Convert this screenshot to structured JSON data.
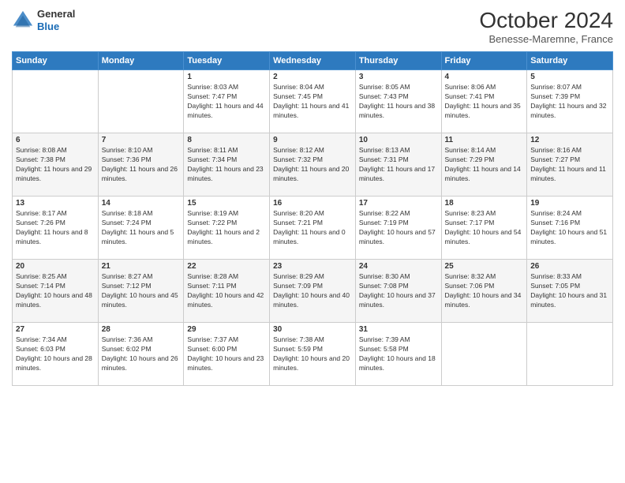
{
  "header": {
    "logo": {
      "line1": "General",
      "line2": "Blue"
    },
    "month_title": "October 2024",
    "subtitle": "Benesse-Maremne, France"
  },
  "days_of_week": [
    "Sunday",
    "Monday",
    "Tuesday",
    "Wednesday",
    "Thursday",
    "Friday",
    "Saturday"
  ],
  "weeks": [
    [
      {
        "day": "",
        "sunrise": "",
        "sunset": "",
        "daylight": ""
      },
      {
        "day": "",
        "sunrise": "",
        "sunset": "",
        "daylight": ""
      },
      {
        "day": "1",
        "sunrise": "Sunrise: 8:03 AM",
        "sunset": "Sunset: 7:47 PM",
        "daylight": "Daylight: 11 hours and 44 minutes."
      },
      {
        "day": "2",
        "sunrise": "Sunrise: 8:04 AM",
        "sunset": "Sunset: 7:45 PM",
        "daylight": "Daylight: 11 hours and 41 minutes."
      },
      {
        "day": "3",
        "sunrise": "Sunrise: 8:05 AM",
        "sunset": "Sunset: 7:43 PM",
        "daylight": "Daylight: 11 hours and 38 minutes."
      },
      {
        "day": "4",
        "sunrise": "Sunrise: 8:06 AM",
        "sunset": "Sunset: 7:41 PM",
        "daylight": "Daylight: 11 hours and 35 minutes."
      },
      {
        "day": "5",
        "sunrise": "Sunrise: 8:07 AM",
        "sunset": "Sunset: 7:39 PM",
        "daylight": "Daylight: 11 hours and 32 minutes."
      }
    ],
    [
      {
        "day": "6",
        "sunrise": "Sunrise: 8:08 AM",
        "sunset": "Sunset: 7:38 PM",
        "daylight": "Daylight: 11 hours and 29 minutes."
      },
      {
        "day": "7",
        "sunrise": "Sunrise: 8:10 AM",
        "sunset": "Sunset: 7:36 PM",
        "daylight": "Daylight: 11 hours and 26 minutes."
      },
      {
        "day": "8",
        "sunrise": "Sunrise: 8:11 AM",
        "sunset": "Sunset: 7:34 PM",
        "daylight": "Daylight: 11 hours and 23 minutes."
      },
      {
        "day": "9",
        "sunrise": "Sunrise: 8:12 AM",
        "sunset": "Sunset: 7:32 PM",
        "daylight": "Daylight: 11 hours and 20 minutes."
      },
      {
        "day": "10",
        "sunrise": "Sunrise: 8:13 AM",
        "sunset": "Sunset: 7:31 PM",
        "daylight": "Daylight: 11 hours and 17 minutes."
      },
      {
        "day": "11",
        "sunrise": "Sunrise: 8:14 AM",
        "sunset": "Sunset: 7:29 PM",
        "daylight": "Daylight: 11 hours and 14 minutes."
      },
      {
        "day": "12",
        "sunrise": "Sunrise: 8:16 AM",
        "sunset": "Sunset: 7:27 PM",
        "daylight": "Daylight: 11 hours and 11 minutes."
      }
    ],
    [
      {
        "day": "13",
        "sunrise": "Sunrise: 8:17 AM",
        "sunset": "Sunset: 7:26 PM",
        "daylight": "Daylight: 11 hours and 8 minutes."
      },
      {
        "day": "14",
        "sunrise": "Sunrise: 8:18 AM",
        "sunset": "Sunset: 7:24 PM",
        "daylight": "Daylight: 11 hours and 5 minutes."
      },
      {
        "day": "15",
        "sunrise": "Sunrise: 8:19 AM",
        "sunset": "Sunset: 7:22 PM",
        "daylight": "Daylight: 11 hours and 2 minutes."
      },
      {
        "day": "16",
        "sunrise": "Sunrise: 8:20 AM",
        "sunset": "Sunset: 7:21 PM",
        "daylight": "Daylight: 11 hours and 0 minutes."
      },
      {
        "day": "17",
        "sunrise": "Sunrise: 8:22 AM",
        "sunset": "Sunset: 7:19 PM",
        "daylight": "Daylight: 10 hours and 57 minutes."
      },
      {
        "day": "18",
        "sunrise": "Sunrise: 8:23 AM",
        "sunset": "Sunset: 7:17 PM",
        "daylight": "Daylight: 10 hours and 54 minutes."
      },
      {
        "day": "19",
        "sunrise": "Sunrise: 8:24 AM",
        "sunset": "Sunset: 7:16 PM",
        "daylight": "Daylight: 10 hours and 51 minutes."
      }
    ],
    [
      {
        "day": "20",
        "sunrise": "Sunrise: 8:25 AM",
        "sunset": "Sunset: 7:14 PM",
        "daylight": "Daylight: 10 hours and 48 minutes."
      },
      {
        "day": "21",
        "sunrise": "Sunrise: 8:27 AM",
        "sunset": "Sunset: 7:12 PM",
        "daylight": "Daylight: 10 hours and 45 minutes."
      },
      {
        "day": "22",
        "sunrise": "Sunrise: 8:28 AM",
        "sunset": "Sunset: 7:11 PM",
        "daylight": "Daylight: 10 hours and 42 minutes."
      },
      {
        "day": "23",
        "sunrise": "Sunrise: 8:29 AM",
        "sunset": "Sunset: 7:09 PM",
        "daylight": "Daylight: 10 hours and 40 minutes."
      },
      {
        "day": "24",
        "sunrise": "Sunrise: 8:30 AM",
        "sunset": "Sunset: 7:08 PM",
        "daylight": "Daylight: 10 hours and 37 minutes."
      },
      {
        "day": "25",
        "sunrise": "Sunrise: 8:32 AM",
        "sunset": "Sunset: 7:06 PM",
        "daylight": "Daylight: 10 hours and 34 minutes."
      },
      {
        "day": "26",
        "sunrise": "Sunrise: 8:33 AM",
        "sunset": "Sunset: 7:05 PM",
        "daylight": "Daylight: 10 hours and 31 minutes."
      }
    ],
    [
      {
        "day": "27",
        "sunrise": "Sunrise: 7:34 AM",
        "sunset": "Sunset: 6:03 PM",
        "daylight": "Daylight: 10 hours and 28 minutes."
      },
      {
        "day": "28",
        "sunrise": "Sunrise: 7:36 AM",
        "sunset": "Sunset: 6:02 PM",
        "daylight": "Daylight: 10 hours and 26 minutes."
      },
      {
        "day": "29",
        "sunrise": "Sunrise: 7:37 AM",
        "sunset": "Sunset: 6:00 PM",
        "daylight": "Daylight: 10 hours and 23 minutes."
      },
      {
        "day": "30",
        "sunrise": "Sunrise: 7:38 AM",
        "sunset": "Sunset: 5:59 PM",
        "daylight": "Daylight: 10 hours and 20 minutes."
      },
      {
        "day": "31",
        "sunrise": "Sunrise: 7:39 AM",
        "sunset": "Sunset: 5:58 PM",
        "daylight": "Daylight: 10 hours and 18 minutes."
      },
      {
        "day": "",
        "sunrise": "",
        "sunset": "",
        "daylight": ""
      },
      {
        "day": "",
        "sunrise": "",
        "sunset": "",
        "daylight": ""
      }
    ]
  ]
}
